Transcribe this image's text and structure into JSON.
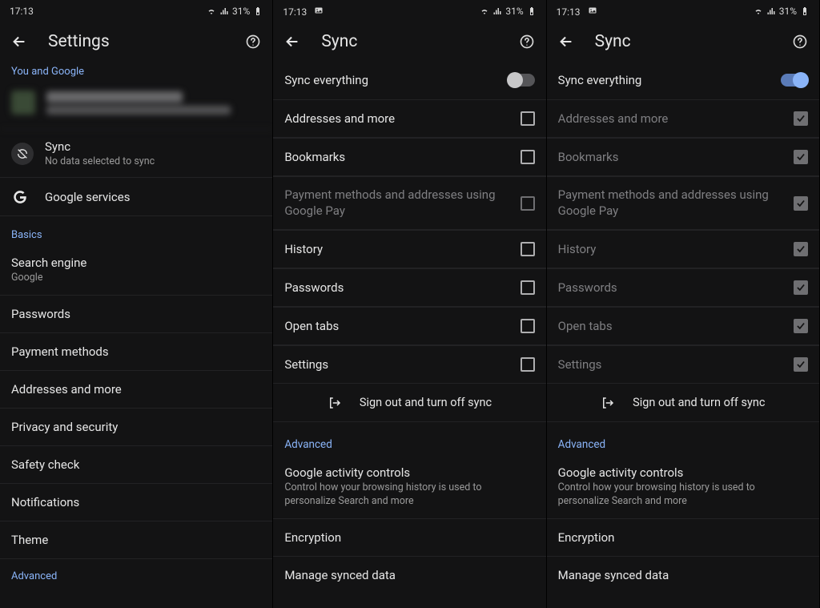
{
  "status": {
    "time": "17:13",
    "battery": "31%",
    "notif_icon": "image-icon"
  },
  "panel1": {
    "title": "Settings",
    "sectionYou": "You and Google",
    "sync": {
      "title": "Sync",
      "sub": "No data selected to sync"
    },
    "google_services": "Google services",
    "basics": "Basics",
    "search_engine": {
      "title": "Search engine",
      "sub": "Google"
    },
    "passwords": "Passwords",
    "payment": "Payment methods",
    "addresses": "Addresses and more",
    "privacy": "Privacy and security",
    "safety": "Safety check",
    "notifications": "Notifications",
    "theme": "Theme",
    "advanced": "Advanced"
  },
  "syncPage": {
    "title": "Sync",
    "sync_everything": "Sync everything",
    "items": [
      "Addresses and more",
      "Bookmarks",
      "Payment methods and addresses using Google Pay",
      "History",
      "Passwords",
      "Open tabs",
      "Settings"
    ],
    "signout": "Sign out and turn off sync",
    "advanced": "Advanced",
    "gac": {
      "title": "Google activity controls",
      "sub": "Control how your browsing history is used to personalize Search and more"
    },
    "encryption": "Encryption",
    "manage": "Manage synced data"
  },
  "panel2": {
    "sync_on": false
  },
  "panel3": {
    "sync_on": true
  }
}
